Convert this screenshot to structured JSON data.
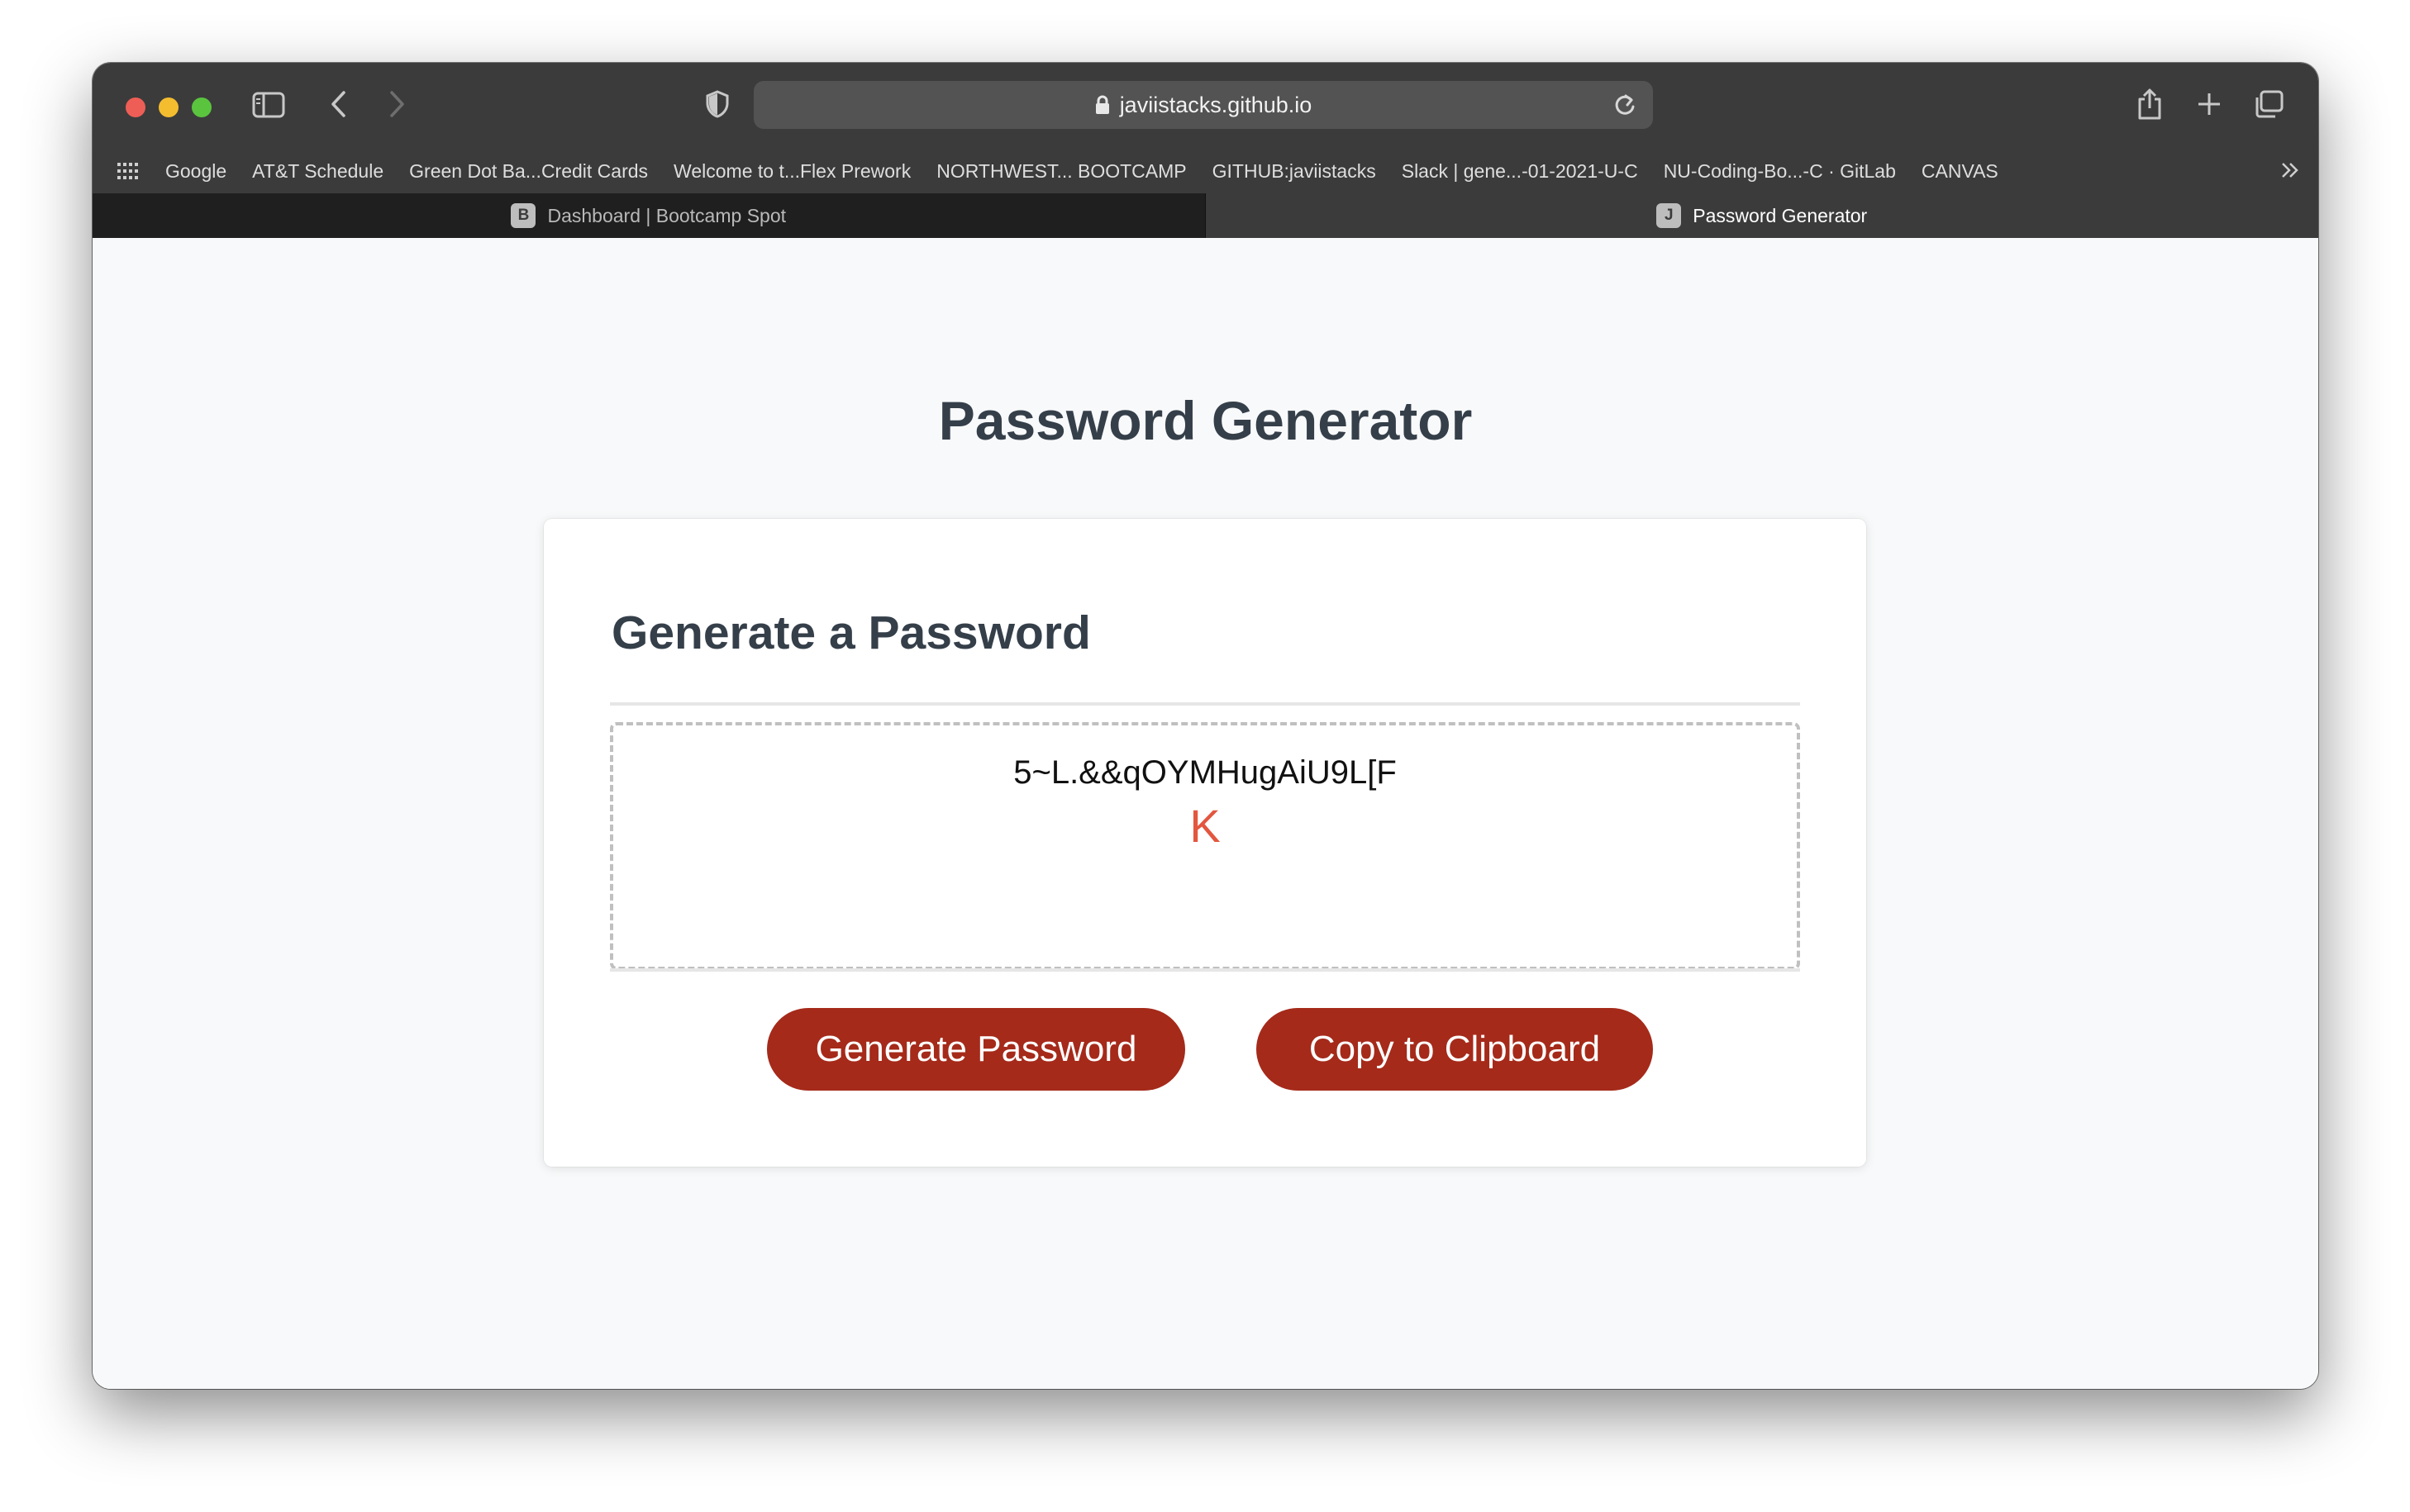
{
  "browser": {
    "url": "javiistacks.github.io",
    "bookmarks": [
      "Google",
      "AT&T Schedule",
      "Green Dot Ba...Credit Cards",
      "Welcome to t...Flex Prework",
      "NORTHWEST... BOOTCAMP",
      "GITHUB:javiistacks",
      "Slack | gene...-01-2021-U-C",
      "NU-Coding-Bo...-C · GitLab",
      "CANVAS"
    ],
    "tabs": [
      {
        "favicon": "B",
        "label": "Dashboard | Bootcamp Spot",
        "active": false
      },
      {
        "favicon": "J",
        "label": "Password Generator",
        "active": true
      }
    ]
  },
  "page": {
    "title": "Password Generator",
    "card_header": "Generate a Password",
    "password_line1": "5~L.&&qOYMHugAiU9L[F",
    "password_line2": "K",
    "generate_button": "Generate Password",
    "copy_button": "Copy to Clipboard"
  },
  "colors": {
    "button": "#a52a1a",
    "heading": "#353f4a",
    "password_accent": "#e3563f"
  }
}
